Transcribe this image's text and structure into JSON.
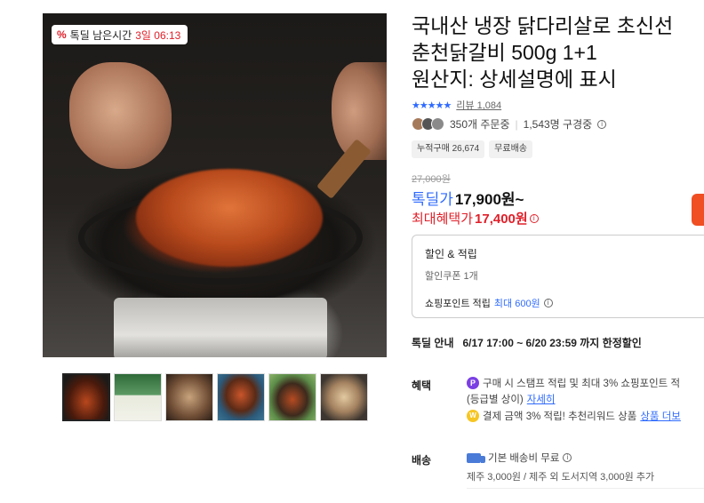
{
  "product": {
    "title_line1": "국내산 냉장 닭다리살로 초신선",
    "title_line2": "춘천닭갈비 500g 1+1",
    "title_line3": "원산지: 상세설명에 표시",
    "stars": "★★★★★",
    "review_label": "리뷰 1,084",
    "avatars_alt": "구매자 아바타",
    "orders": "350개 주문중",
    "watchers": "1,543명 구경중",
    "chips": [
      "누적구매 26,674",
      "무료배송"
    ]
  },
  "deal_tag": {
    "label": "톡딜 남은시간",
    "time": "3일 06:13"
  },
  "price": {
    "original": "27,000원",
    "deal_label": "톡딜가",
    "deal_value": "17,900원~",
    "max_label": "최대혜택가",
    "max_value": "17,400원"
  },
  "discount": {
    "header": "할인 & 적립",
    "coupon": "할인쿠폰 1개",
    "point_label": "쇼핑포인트 적립",
    "point_value": "최대 600원"
  },
  "deal_guide": {
    "label": "톡딜 안내",
    "value": "6/17 17:00 ~ 6/20 23:59 까지 한정할인"
  },
  "benefits": {
    "label": "혜택",
    "row1": "구매 시 스탬프 적립 및 최대 3% 쇼핑포인트 적",
    "row1b": "(등급별 상이)",
    "row1b_link": "자세히",
    "row2": "결제 금액 3% 적립! 추천리워드 상품",
    "row2_link": "상품 더보"
  },
  "shipping": {
    "label": "배송",
    "basic": "기본 배송비 무료",
    "sub": "제주 3,000원 / 제주 외 도서지역 3,000원 추가"
  },
  "icons": {
    "deal": "percent-icon",
    "info": "info-icon",
    "point": "point-icon",
    "reward": "reward-icon",
    "truck": "truck-icon"
  },
  "colors": {
    "accent_blue": "#2f6bff",
    "accent_red": "#e0202a",
    "buy_orange": "#f04e23"
  }
}
